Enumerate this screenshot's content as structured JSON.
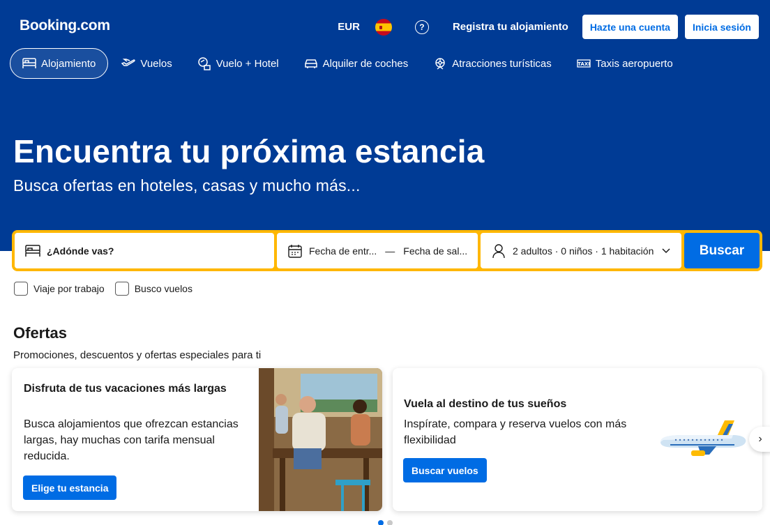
{
  "header": {
    "logo": "Booking.com",
    "currency": "EUR",
    "flag_icon": "spain-flag-icon",
    "help_icon": "question-circle-icon",
    "register_property": "Registra tu alojamiento",
    "create_account": "Hazte una cuenta",
    "sign_in": "Inicia sesión"
  },
  "nav": {
    "items": [
      {
        "label": "Alojamiento",
        "icon": "bed-icon",
        "active": true
      },
      {
        "label": "Vuelos",
        "icon": "plane-icon",
        "active": false
      },
      {
        "label": "Vuelo + Hotel",
        "icon": "flight-hotel-icon",
        "active": false
      },
      {
        "label": "Alquiler de coches",
        "icon": "car-icon",
        "active": false
      },
      {
        "label": "Atracciones turísticas",
        "icon": "attractions-icon",
        "active": false
      },
      {
        "label": "Taxis aeropuerto",
        "icon": "taxi-icon",
        "active": false
      }
    ]
  },
  "hero": {
    "title": "Encuentra tu próxima estancia",
    "subtitle": "Busca ofertas en hoteles, casas y mucho más..."
  },
  "search": {
    "destination_placeholder": "¿Adónde vas?",
    "checkin_placeholder": "Fecha de entr...",
    "separator": "—",
    "checkout_placeholder": "Fecha de sal...",
    "guests": "2 adultos · 0 niños · 1 habitación",
    "button": "Buscar",
    "work_trip": "Viaje por trabajo",
    "find_flights": "Busco vuelos"
  },
  "offers": {
    "title": "Ofertas",
    "subtitle": "Promociones, descuentos y ofertas especiales para ti",
    "cards": [
      {
        "title": "Disfruta de tus vacaciones más largas",
        "text": "Busca alojamientos que ofrezcan estancias largas, hay muchas con tarifa mensual reducida.",
        "button": "Elige tu estancia"
      },
      {
        "title": "Vuela al destino de tus sueños",
        "text": "Inspírate, compara y reserva vuelos con más flexibilidad",
        "button": "Buscar vuelos"
      }
    ],
    "next": "›"
  },
  "colors": {
    "brand_blue": "#003b95",
    "action_blue": "#006ce4",
    "search_border": "#ffb700"
  }
}
